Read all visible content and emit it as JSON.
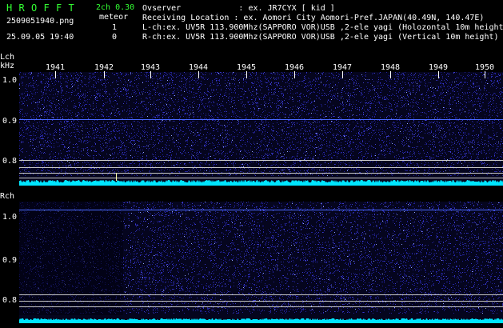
{
  "header": {
    "brand_letters": [
      "H",
      "R",
      "O",
      "F",
      "F",
      "T"
    ],
    "filename": "2509051940.png",
    "datetime": "25.09.05 19:40",
    "channel": "2ch 0.30",
    "meteor_label": "meteor",
    "count_l": "1",
    "count_r": "0",
    "observer": "Ovserver            : ex. JR7CYX [ kid ]",
    "location": "Receiving Location : ex. Aomori City Aomori-Pref.JAPAN(40.49N, 140.47E)",
    "lch_info": "L-ch:ex. UV5R 113.900Mhz(SAPPORO VOR)USB ,2-ele yagi (Holozontal 10m height)",
    "rch_info": "R-ch:ex. UV5R 113.900Mhz(SAPPORO VOR)USB ,2-ele yagi (Vertical 10m height)"
  },
  "lch": {
    "label": "Lch",
    "unit": "kHz",
    "y_labels": [
      "1.0",
      "0.9",
      "0.8"
    ],
    "years": [
      "1941",
      "1942",
      "1943",
      "1944",
      "1945",
      "1946",
      "1947",
      "1948",
      "1949",
      "1950"
    ]
  },
  "rch": {
    "label": "Rch",
    "y_labels": [
      "1.0",
      "0.9",
      "0.8"
    ]
  },
  "colors": {
    "background": "#000000",
    "noise": "#1a1a7a",
    "signal_line": "#4a6aff",
    "baseline": "#00e5ff",
    "ref_line": "#c8c8c8",
    "header_green": "#33ff33"
  }
}
